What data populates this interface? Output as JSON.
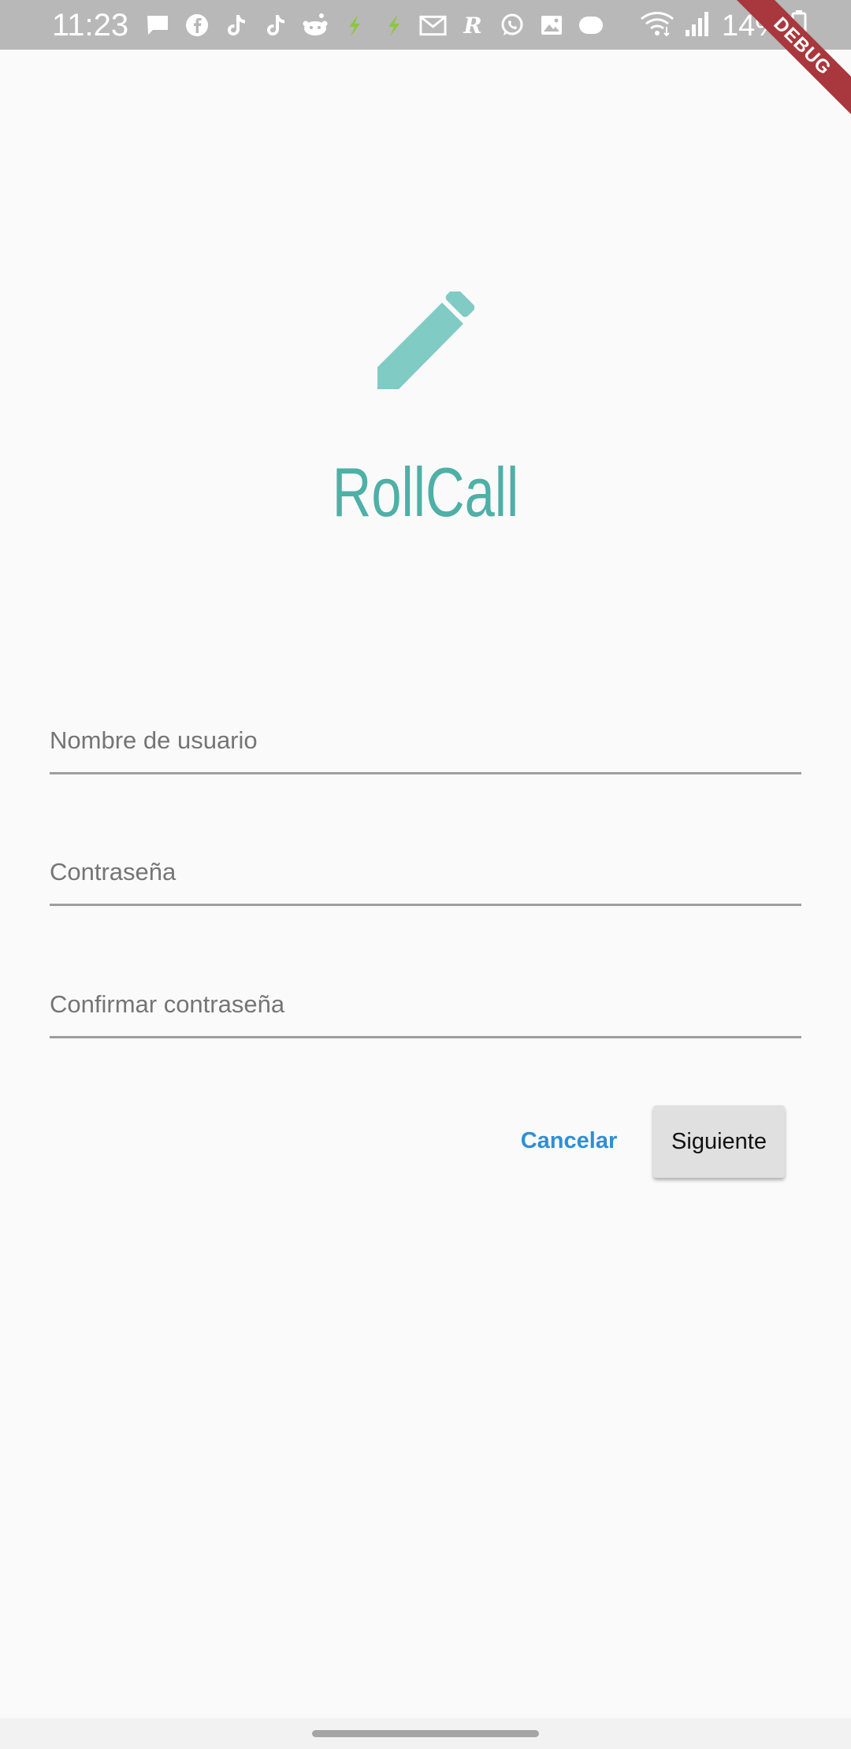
{
  "status_bar": {
    "time": "11:23",
    "battery": "14%",
    "notification_icons": [
      "message-icon",
      "facebook-icon",
      "tiktok-icon",
      "tiktok-icon",
      "reddit-icon",
      "app-bolt-icon",
      "app-bolt-icon",
      "gmail-icon",
      "r-app-icon",
      "whatsapp-icon",
      "gallery-icon",
      "dex-icon"
    ]
  },
  "debug_banner": "DEBUG",
  "app": {
    "title": "RollCall",
    "accent_color": "#4eb0a6",
    "icon": "pencil-icon"
  },
  "form": {
    "username_placeholder": "Nombre de usuario",
    "password_placeholder": "Contraseña",
    "confirm_placeholder": "Confirmar contraseña"
  },
  "actions": {
    "cancel_label": "Cancelar",
    "next_label": "Siguiente"
  }
}
